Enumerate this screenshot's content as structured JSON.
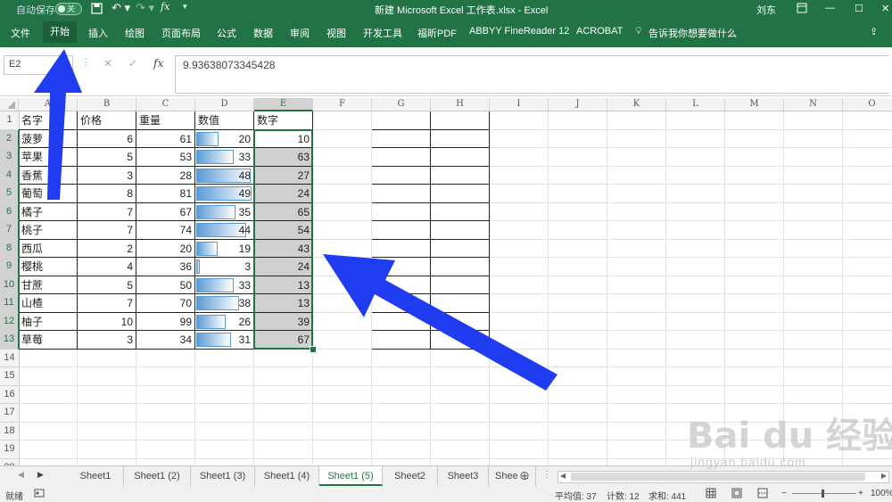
{
  "titlebar": {
    "autosave_label": "自动保存",
    "autosave_state": "关",
    "doc_title": "新建 Microsoft Excel 工作表.xlsx - Excel",
    "user": "刘东"
  },
  "ribbon": {
    "tabs": [
      "文件",
      "开始",
      "插入",
      "绘图",
      "页面布局",
      "公式",
      "数据",
      "审阅",
      "视图",
      "开发工具",
      "福昕PDF",
      "ABBYY FineReader 12",
      "ACROBAT"
    ],
    "active_tab": "开始",
    "tell_me": "告诉我你想要做什么"
  },
  "formula_bar": {
    "name_box": "E2",
    "fx_label": "fx",
    "value": "9.93638073345428"
  },
  "columns": [
    "A",
    "B",
    "C",
    "D",
    "E",
    "F",
    "G",
    "H",
    "I",
    "J",
    "K",
    "L",
    "M",
    "N",
    "O"
  ],
  "rows": [
    "1",
    "2",
    "3",
    "4",
    "5",
    "6",
    "7",
    "8",
    "9",
    "10",
    "11",
    "12",
    "13",
    "14",
    "15",
    "16",
    "17",
    "18",
    "19",
    "20"
  ],
  "table": {
    "headers": [
      "名字",
      "价格",
      "重量",
      "数值",
      "数字"
    ],
    "rows": [
      {
        "name": "菠萝",
        "price": "6",
        "weight": "61",
        "value": "20",
        "number": "10"
      },
      {
        "name": "苹果",
        "price": "5",
        "weight": "53",
        "value": "33",
        "number": "63"
      },
      {
        "name": "香蕉",
        "price": "3",
        "weight": "28",
        "value": "48",
        "number": "27"
      },
      {
        "name": "葡萄",
        "price": "8",
        "weight": "81",
        "value": "49",
        "number": "24"
      },
      {
        "name": "橘子",
        "price": "7",
        "weight": "67",
        "value": "35",
        "number": "65"
      },
      {
        "name": "桃子",
        "price": "7",
        "weight": "74",
        "value": "44",
        "number": "54"
      },
      {
        "name": "西瓜",
        "price": "2",
        "weight": "20",
        "value": "19",
        "number": "43"
      },
      {
        "name": "樱桃",
        "price": "4",
        "weight": "36",
        "value": "3",
        "number": "24"
      },
      {
        "name": "甘蔗",
        "price": "5",
        "weight": "50",
        "value": "33",
        "number": "13"
      },
      {
        "name": "山楂",
        "price": "7",
        "weight": "70",
        "value": "38",
        "number": "13"
      },
      {
        "name": "柚子",
        "price": "10",
        "weight": "99",
        "value": "26",
        "number": "39"
      },
      {
        "name": "草莓",
        "price": "3",
        "weight": "34",
        "value": "31",
        "number": "67"
      }
    ],
    "databar_max": 49
  },
  "sheet_tabs": [
    "Sheet1",
    "Sheet1 (2)",
    "Sheet1 (3)",
    "Sheet1 (4)",
    "Sheet1 (5)",
    "Sheet2",
    "Sheet3",
    "Shee ..."
  ],
  "active_sheet": "Sheet1 (5)",
  "status": {
    "mode": "就绪",
    "average": "平均值: 37",
    "count": "计数: 12",
    "sum": "求和: 441",
    "zoom": "100%"
  },
  "watermark": {
    "text": "Bai du 经验",
    "url": "jingyan.baidu.com"
  },
  "colors": {
    "excel_green": "#217346",
    "databar": "#5b9bd5",
    "arrow": "#1f3cf0",
    "shade": "#d0d0d0"
  }
}
